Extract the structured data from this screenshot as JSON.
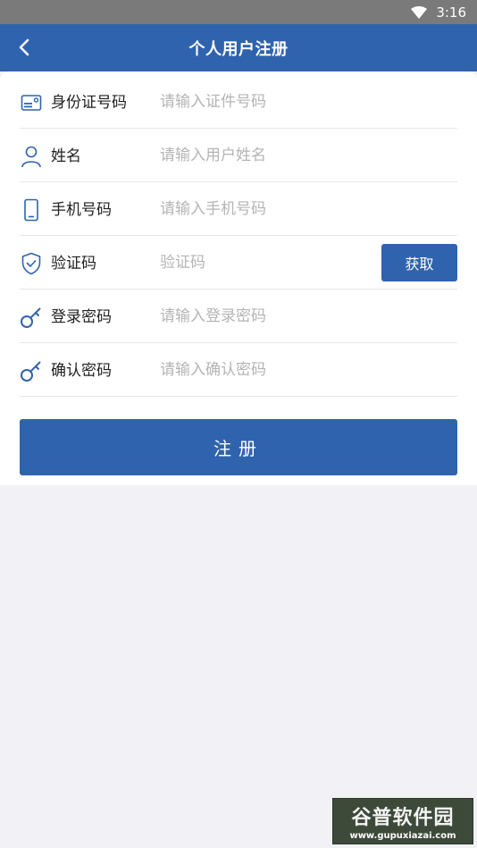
{
  "status_bar": {
    "time": "3:16",
    "wifi_icon": "wifi-icon"
  },
  "header": {
    "title": "个人用户注册",
    "back_icon": "back-arrow-icon"
  },
  "form": {
    "id_card": {
      "label": "身份证号码",
      "placeholder": "请输入证件号码",
      "value": "",
      "icon": "id-card-icon"
    },
    "name": {
      "label": "姓名",
      "placeholder": "请输入用户姓名",
      "value": "",
      "icon": "user-icon"
    },
    "phone": {
      "label": "手机号码",
      "placeholder": "请输入手机号码",
      "value": "",
      "icon": "phone-icon"
    },
    "code": {
      "label": "验证码",
      "placeholder": "验证码",
      "value": "",
      "icon": "shield-check-icon",
      "button_label": "获取"
    },
    "password": {
      "label": "登录密码",
      "placeholder": "请输入登录密码",
      "value": "",
      "icon": "key-icon"
    },
    "confirm_password": {
      "label": "确认密码",
      "placeholder": "请输入确认密码",
      "value": "",
      "icon": "key-icon"
    },
    "submit_label": "注册"
  },
  "watermark": {
    "title": "谷普软件园",
    "url": "www.gupuxiazai.com"
  },
  "colors": {
    "primary": "#2f63ad",
    "status_bar": "#7a7a7a",
    "background": "#f2f2f6",
    "placeholder": "#b4b4b4"
  }
}
